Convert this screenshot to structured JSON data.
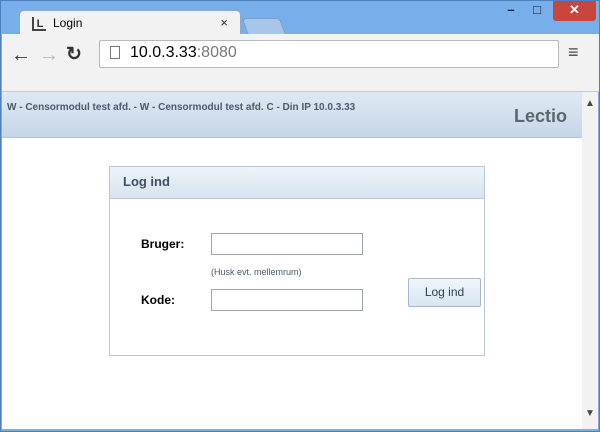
{
  "tab": {
    "title": "Login",
    "close": "×",
    "favicon": "L"
  },
  "window_controls": {
    "minimize": "–",
    "maximize": "□",
    "close": "✕"
  },
  "toolbar": {
    "url_host": "10.0.3.33",
    "url_port": ":8080"
  },
  "header": {
    "text": "W - Censormodul test afd. - W - Censormodul test afd. C - Din IP 10.0.3.33",
    "logo": "Lectio"
  },
  "login": {
    "title": "Log ind",
    "user_label": "Bruger:",
    "user_value": "",
    "hint": "(Husk evt. mellemrum)",
    "pass_label": "Kode:",
    "pass_value": "",
    "submit_label": "Log ind"
  }
}
